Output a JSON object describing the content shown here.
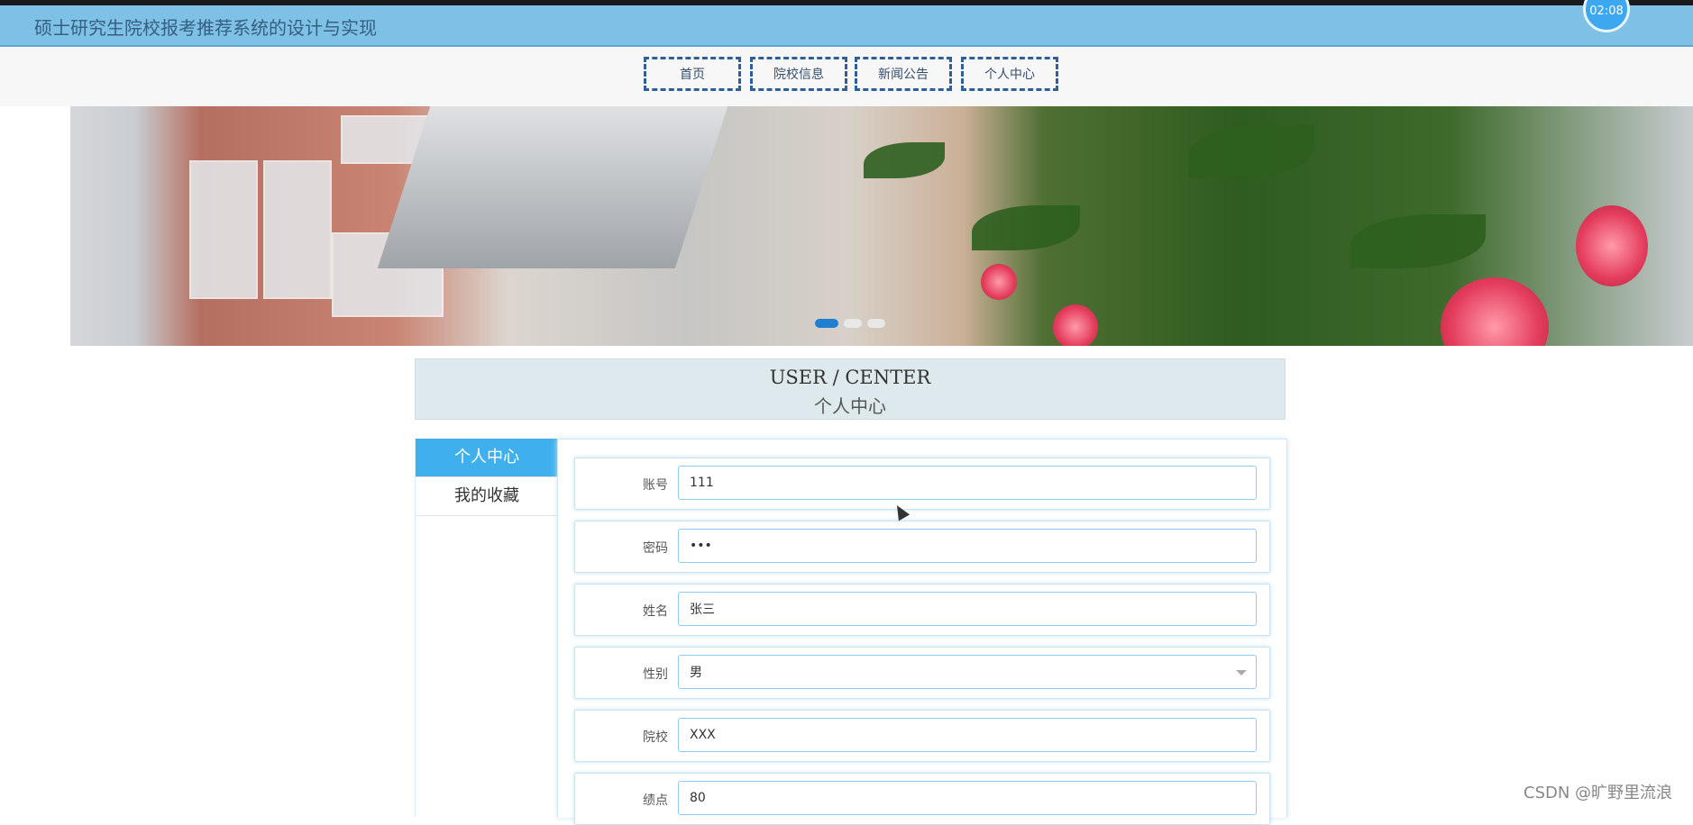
{
  "header": {
    "site_title": "硕士研究生院校报考推荐系统的设计与实现",
    "clock": "02:08"
  },
  "nav": {
    "items": [
      "首页",
      "院校信息",
      "新闻公告",
      "个人中心"
    ]
  },
  "banner": {
    "slide_count": 3,
    "active_slide": 1
  },
  "user_center": {
    "title_en": "USER / CENTER",
    "title_cn": "个人中心"
  },
  "sidebar": {
    "items": [
      "个人中心",
      "我的收藏"
    ],
    "active": "个人中心"
  },
  "form": {
    "fields": [
      {
        "label": "账号",
        "value": "111"
      },
      {
        "label": "密码",
        "value": "•••"
      },
      {
        "label": "姓名",
        "value": "张三"
      },
      {
        "label": "性别",
        "value": "男"
      },
      {
        "label": "院校",
        "value": "XXX"
      },
      {
        "label": "绩点",
        "value": "80"
      }
    ]
  },
  "watermark": "CSDN @旷野里流浪",
  "colors": {
    "header_bg": "#7fc0e6",
    "accent": "#3fb0ec",
    "nav_border": "#2f5f9a",
    "input_border": "#8fcaf0"
  }
}
